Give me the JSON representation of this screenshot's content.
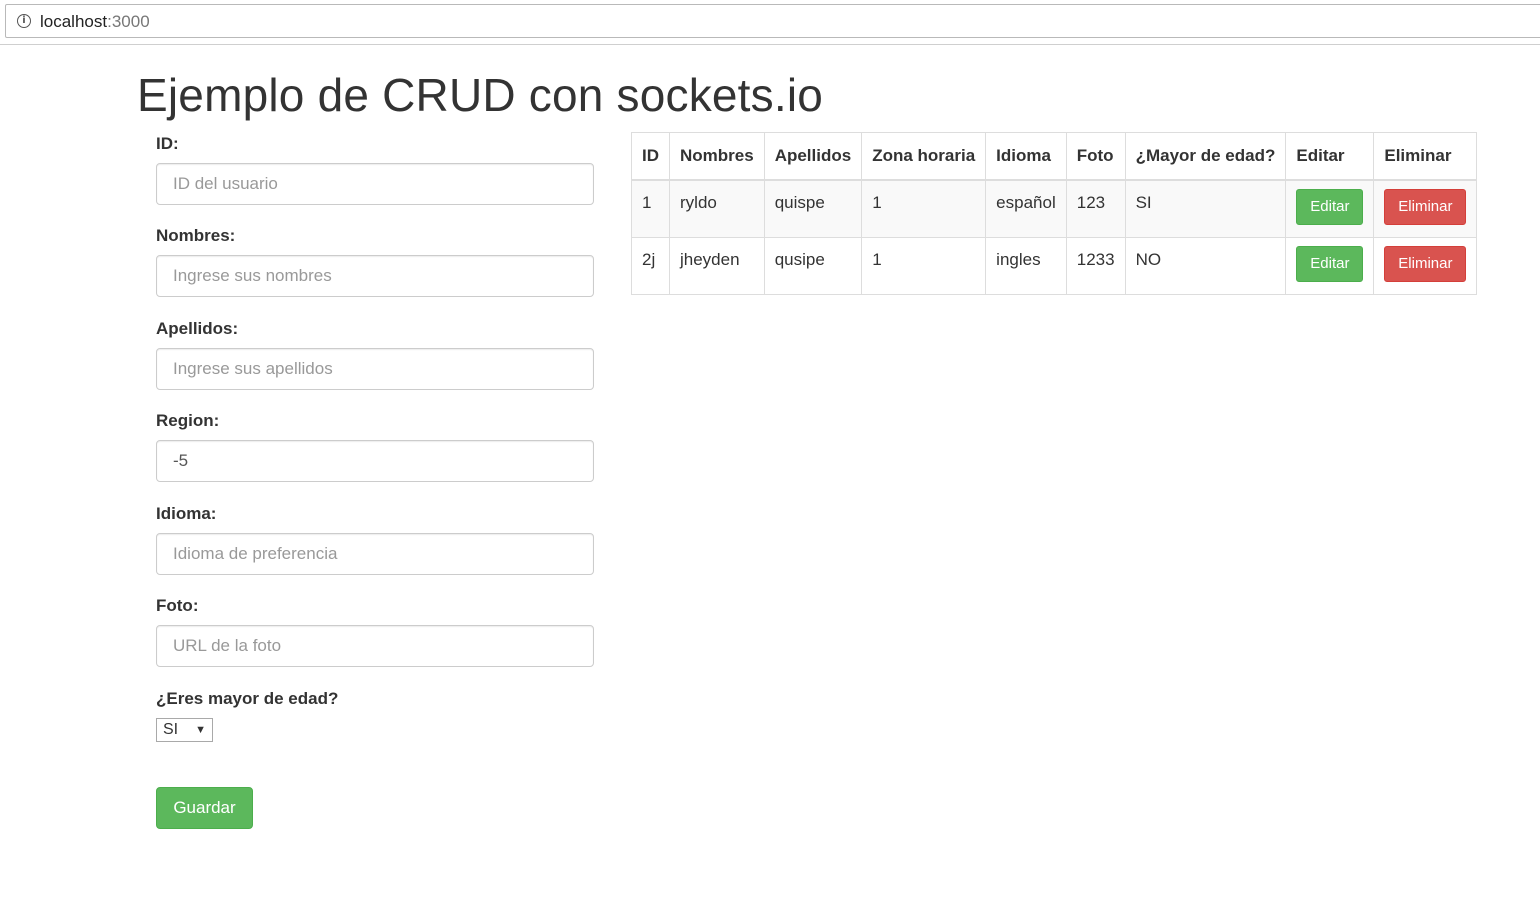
{
  "browser": {
    "url_host": "localhost",
    "url_port": ":3000"
  },
  "page": {
    "title": "Ejemplo de CRUD con sockets.io"
  },
  "form": {
    "id_label": "ID:",
    "id_placeholder": "ID del usuario",
    "nombres_label": "Nombres:",
    "nombres_placeholder": "Ingrese sus nombres",
    "apellidos_label": "Apellidos:",
    "apellidos_placeholder": "Ingrese sus apellidos",
    "region_label": "Region:",
    "region_value": "-5",
    "idioma_label": "Idioma:",
    "idioma_placeholder": "Idioma de preferencia",
    "foto_label": "Foto:",
    "foto_placeholder": "URL de la foto",
    "mayor_label": "¿Eres mayor de edad?",
    "mayor_selected": "SI",
    "save_label": "Guardar"
  },
  "table": {
    "headers": [
      "ID",
      "Nombres",
      "Apellidos",
      "Zona horaria",
      "Idioma",
      "Foto",
      "¿Mayor de edad?",
      "Editar",
      "Eliminar"
    ],
    "rows": [
      {
        "id": "1",
        "nombres": "ryldo",
        "apellidos": "quispe",
        "zona": "1",
        "idioma": "español",
        "foto": "123",
        "mayor": "SI",
        "edit": "Editar",
        "delete": "Eliminar"
      },
      {
        "id": "2j",
        "nombres": "jheyden",
        "apellidos": "qusipe",
        "zona": "1",
        "idioma": "ingles",
        "foto": "1233",
        "mayor": "NO",
        "edit": "Editar",
        "delete": "Eliminar"
      }
    ]
  },
  "colors": {
    "success": "#5cb85c",
    "danger": "#d9534f"
  }
}
